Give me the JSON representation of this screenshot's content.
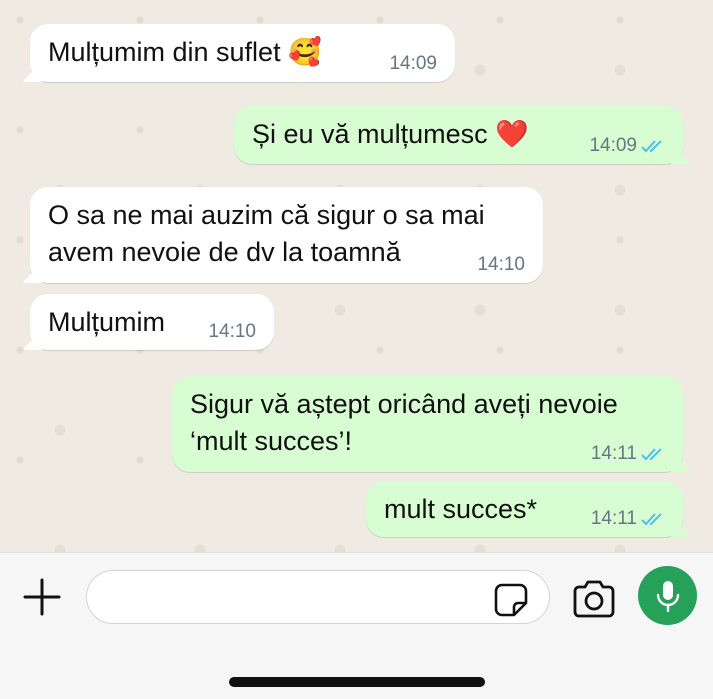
{
  "messages": [
    {
      "direction": "incoming",
      "text": "Mulțumim din suflet 🥰",
      "time": "14:09"
    },
    {
      "direction": "outgoing",
      "text": "Și eu vă mulțumesc ❤️",
      "time": "14:09",
      "status": "read"
    },
    {
      "direction": "incoming",
      "text": "O sa ne mai auzim că sigur o sa mai\navem nevoie de dv la toamnă",
      "time": "14:10"
    },
    {
      "direction": "incoming",
      "text": "Mulțumim",
      "time": "14:10"
    },
    {
      "direction": "outgoing",
      "text": "Sigur vă aștept oricând aveți nevoie\n‘mult succes’!",
      "time": "14:11",
      "status": "read"
    },
    {
      "direction": "outgoing",
      "text": "mult succes*",
      "time": "14:11",
      "status": "read"
    }
  ],
  "input": {
    "value": "",
    "placeholder": ""
  },
  "icons": {
    "attach": "plus-icon",
    "sticker": "sticker-icon",
    "camera": "camera-icon",
    "mic": "microphone-icon",
    "read_ticks": "double-check-icon"
  },
  "colors": {
    "incoming_bubble": "#ffffff",
    "outgoing_bubble": "#d9fdd3",
    "read_ticks": "#53bdeb",
    "mic_button": "#25a15a",
    "chat_background": "#efeae2"
  }
}
